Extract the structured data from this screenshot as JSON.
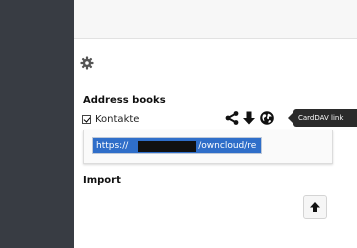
{
  "settings": {
    "icon": "gear-icon"
  },
  "address_books": {
    "heading": "Address books",
    "items": [
      {
        "name": "Kontakte",
        "enabled": true,
        "actions": [
          "share-icon",
          "download-icon",
          "globe-icon"
        ],
        "tooltip": "CardDAV link",
        "link": {
          "prefix": "https://",
          "suffix": "/owncloud/re"
        }
      }
    ]
  },
  "import": {
    "heading": "Import",
    "button_icon": "upload-arrow-icon"
  }
}
